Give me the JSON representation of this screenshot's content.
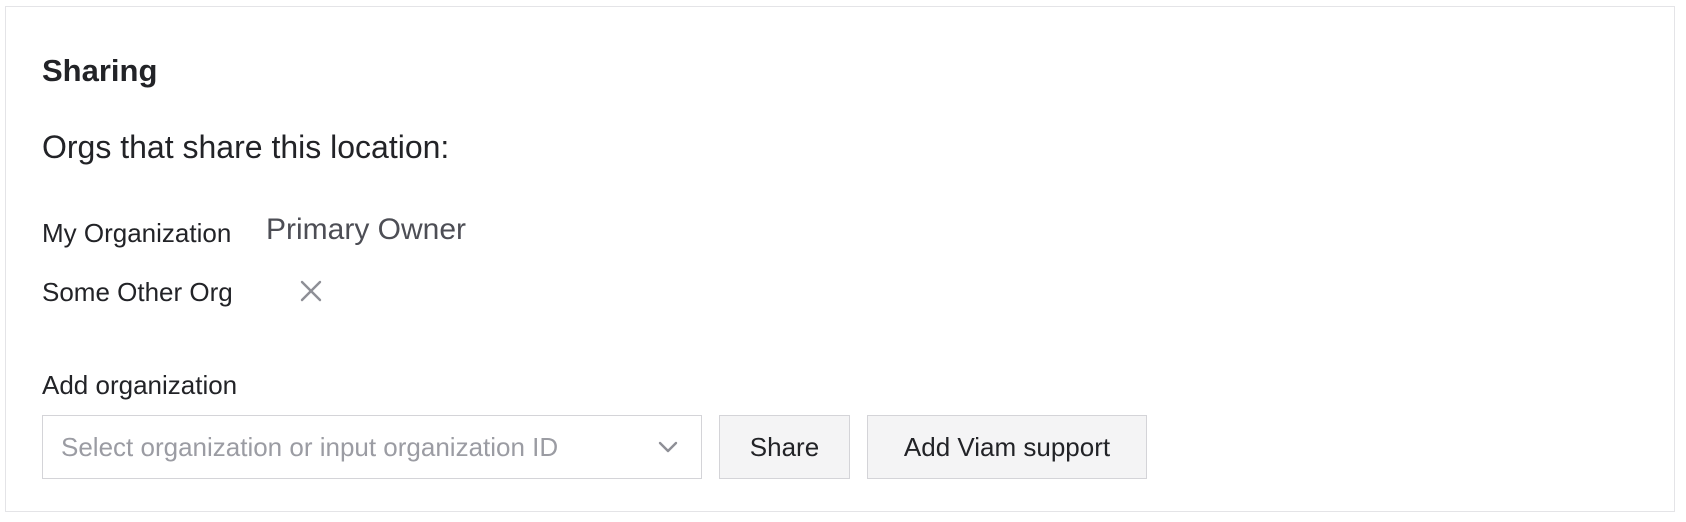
{
  "panel": {
    "title": "Sharing",
    "subtitle": "Orgs that share this location:"
  },
  "orgs": [
    {
      "name": "My Organization",
      "role": "Primary Owner"
    },
    {
      "name": "Some Other Org",
      "remove_icon": "close-icon"
    }
  ],
  "add_org": {
    "label": "Add organization",
    "placeholder": "Select organization or input organization ID",
    "value": "",
    "dropdown_icon": "chevron-down-icon"
  },
  "buttons": {
    "share": "Share",
    "add_support": "Add Viam support"
  },
  "colors": {
    "text": "#222327",
    "muted_text": "#4d4e55",
    "placeholder": "#9b9ca3",
    "border": "#d4d4d8",
    "button_bg": "#f4f4f5",
    "icon": "#8e8f96"
  }
}
